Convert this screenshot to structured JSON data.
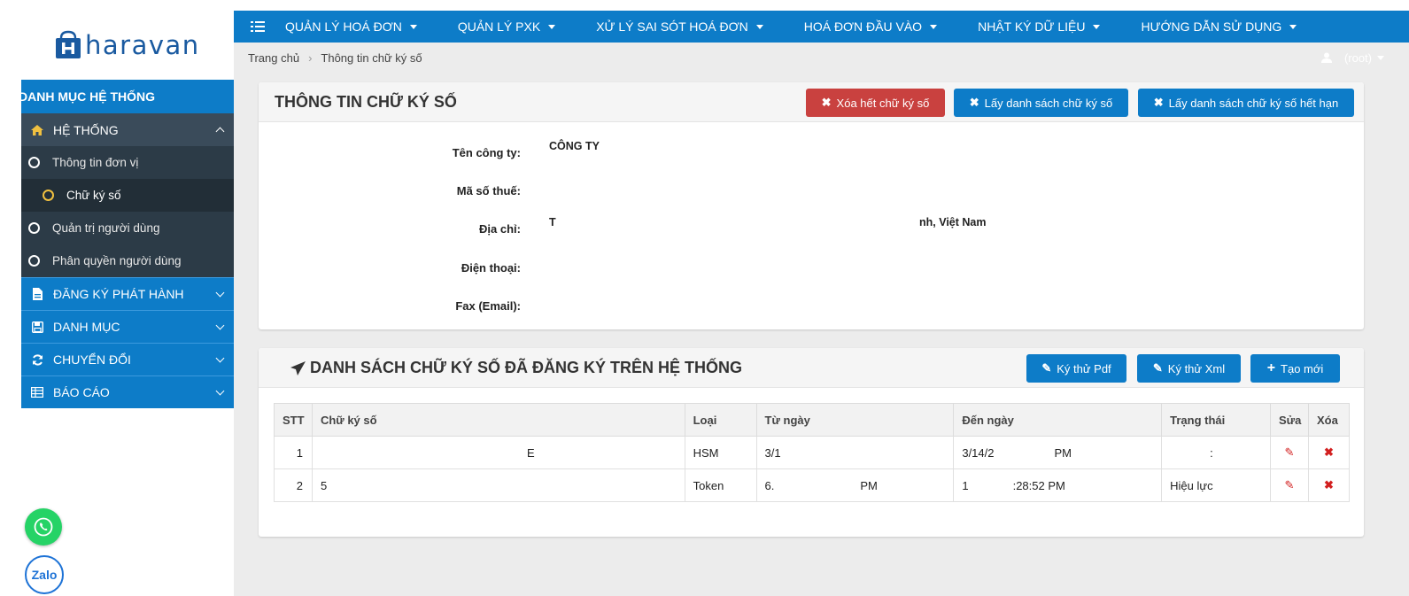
{
  "brand": {
    "name": "haravan",
    "color": "#1a5aa0"
  },
  "topnav": {
    "menu_icon": "list-icon",
    "items": [
      {
        "label": "QUẢN LÝ HOÁ ĐƠN"
      },
      {
        "label": "QUẢN LÝ PXK"
      },
      {
        "label": "XỬ LÝ SAI SÓT HOÁ ĐƠN"
      },
      {
        "label": "HOÁ ĐƠN ĐẦU VÀO"
      },
      {
        "label": "NHẬT KÝ DỮ LIỆU"
      },
      {
        "label": "HƯỚNG DẪN SỬ DỤNG"
      }
    ]
  },
  "breadcrumb": {
    "home": "Trang chủ",
    "current": "Thông tin chữ ký số"
  },
  "user": {
    "name": "(root)"
  },
  "sidebar": {
    "header": "DANH MỤC HỆ THỐNG",
    "system": {
      "label": "HỆ THỐNG"
    },
    "subitems": [
      {
        "label": "Thông tin đơn vị"
      },
      {
        "label": "Chữ ký số"
      },
      {
        "label": "Quản trị người dùng"
      },
      {
        "label": "Phân quyền người dùng"
      }
    ],
    "groups": [
      {
        "label": "ĐĂNG KÝ PHÁT HÀNH",
        "icon": "file-icon"
      },
      {
        "label": "DANH MỤC",
        "icon": "save-icon"
      },
      {
        "label": "CHUYỂN ĐỔI",
        "icon": "refresh-icon"
      },
      {
        "label": "BÁO CÁO",
        "icon": "table-icon"
      }
    ]
  },
  "info_panel": {
    "title": "THÔNG TIN CHỮ KÝ SỐ",
    "buttons": {
      "delete_all": "Xóa hết chữ ký số",
      "get_list": "Lấy danh sách chữ ký số",
      "get_expired": "Lấy danh sách chữ ký số hết hạn"
    },
    "fields": {
      "company_label": "Tên công ty:",
      "company_value": "CÔNG TY",
      "tax_label": "Mã số thuế:",
      "tax_value": "",
      "address_label": "Địa chỉ:",
      "address_value_start": "T",
      "address_value_end": "nh, Việt Nam",
      "phone_label": "Điện thoại:",
      "phone_value": "",
      "fax_label": "Fax (Email):",
      "fax_value": ""
    }
  },
  "list_panel": {
    "title": "DANH SÁCH CHỮ KÝ SỐ ĐÃ ĐĂNG KÝ TRÊN HỆ THỐNG",
    "buttons": {
      "sign_pdf": "Ký thử Pdf",
      "sign_xml": "Ký thử Xml",
      "create": "Tạo mới"
    },
    "columns": {
      "stt": "STT",
      "cert": "Chữ ký số",
      "type": "Loại",
      "from": "Từ ngày",
      "to": "Đến ngày",
      "status": "Trạng thái",
      "edit": "Sửa",
      "delete": "Xóa"
    },
    "rows": [
      {
        "stt": "1",
        "cert": "E",
        "type": "HSM",
        "from": "3/1",
        "to": "3/14/2",
        "to_end": "PM",
        "status": ":"
      },
      {
        "stt": "2",
        "cert": "5",
        "type": "Token",
        "from": "6.",
        "from_end": "PM",
        "to": "1",
        "to_end": ":28:52 PM",
        "status": "Hiệu lực"
      }
    ]
  },
  "floating": {
    "zalo": "Zalo"
  },
  "colors": {
    "primary": "#0d7cc8",
    "danger": "#c9413f",
    "sidebar_dark": "#2c3b47",
    "whatsapp": "#25d366"
  }
}
